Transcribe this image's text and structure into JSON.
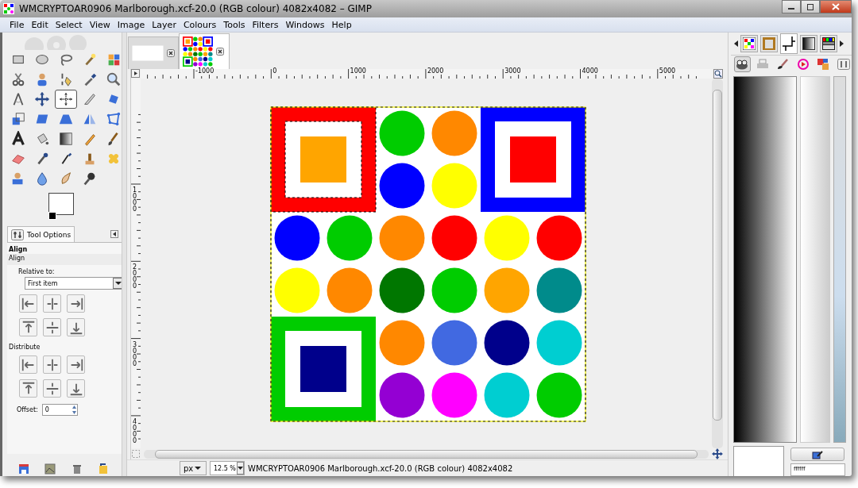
{
  "window": {
    "title": "WMCRYPTOAR0906 Marlborough.xcf-20.0 (RGB colour) 4082x4082 – GIMP"
  },
  "menu": [
    "File",
    "Edit",
    "Select",
    "View",
    "Image",
    "Layer",
    "Colours",
    "Tools",
    "Filters",
    "Windows",
    "Help"
  ],
  "tools": [
    {
      "selected": false
    },
    {
      "selected": false
    },
    {
      "selected": false
    },
    {
      "selected": false
    },
    {
      "selected": false
    },
    {
      "selected": false
    },
    {
      "selected": false
    },
    {
      "selected": false
    },
    {
      "selected": false
    },
    {
      "selected": false
    },
    {
      "selected": false
    },
    {
      "selected": false
    },
    {
      "selected": true
    },
    {
      "selected": false
    },
    {
      "selected": false
    },
    {
      "selected": false
    },
    {
      "selected": false
    },
    {
      "selected": false
    },
    {
      "selected": false
    },
    {
      "selected": false
    },
    {
      "selected": false
    },
    {
      "selected": false
    },
    {
      "selected": false
    },
    {
      "selected": false
    },
    {
      "selected": false
    },
    {
      "selected": false
    },
    {
      "selected": false
    },
    {
      "selected": false
    },
    {
      "selected": false
    },
    {
      "selected": false
    },
    {
      "selected": false
    },
    {
      "selected": false
    },
    {
      "selected": false
    },
    {
      "selected": false
    }
  ],
  "tool_options": {
    "tab": "Tool Options",
    "title": "Align",
    "section": "Align",
    "relative_label": "Relative to:",
    "relative_value": "First item",
    "distribute_label": "Distribute",
    "offset_label": "Offset:",
    "offset_value": "0"
  },
  "image_tabs": [
    {
      "selected": false
    },
    {
      "selected": true
    }
  ],
  "ruler_h": [
    "-1000",
    "0",
    "1000",
    "2000",
    "3000",
    "4000",
    "5000"
  ],
  "ruler_v": [
    "1000",
    "2000",
    "3000",
    "4000"
  ],
  "status": {
    "unit": "px",
    "zoom": "12.5 %",
    "text": "WMCRYPTOAR0906 Marlborough.xcf-20.0 (RGB colour) 4082x4082"
  },
  "dock": {
    "tabs": [
      {
        "selected": false
      },
      {
        "selected": false
      },
      {
        "selected": true
      },
      {
        "selected": false
      },
      {
        "selected": false
      }
    ],
    "subtabs": [
      {
        "selected": true
      },
      {
        "selected": false
      },
      {
        "selected": false
      },
      {
        "selected": false
      },
      {
        "selected": false
      },
      {
        "selected": false
      }
    ],
    "hex_value": "ffffff"
  }
}
